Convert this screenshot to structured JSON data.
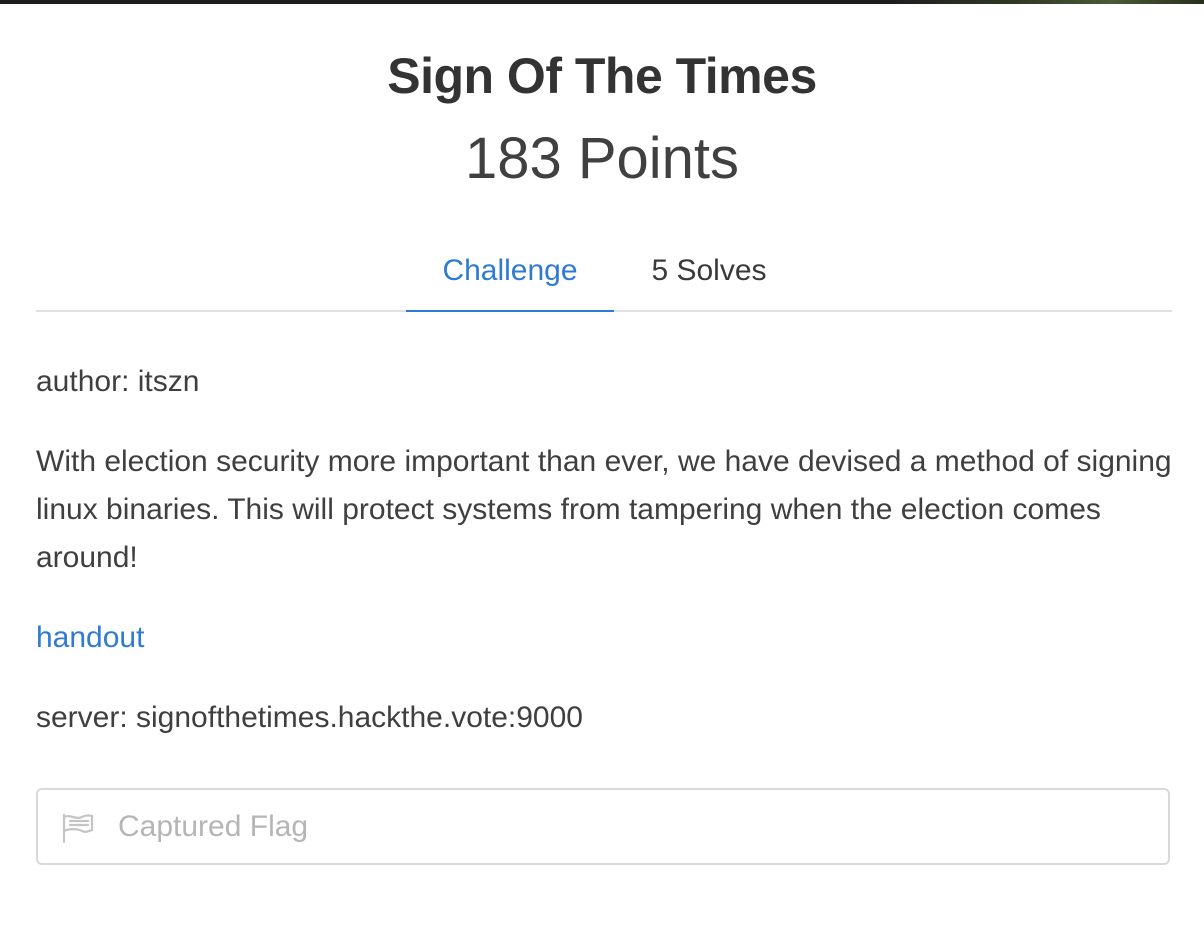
{
  "challenge": {
    "title": "Sign Of The Times",
    "points": "183 Points"
  },
  "tabs": [
    {
      "label": "Challenge",
      "active": true
    },
    {
      "label": "5 Solves",
      "active": false
    }
  ],
  "body": {
    "author": "author: itszn",
    "description": "With election security more important than ever, we have devised a method of signing linux binaries. This will protect systems from tampering when the election comes around!",
    "handout_link": "handout",
    "server": "server: signofthetimes.hackthe.vote:9000"
  },
  "flag_input": {
    "icon": "flag-icon",
    "placeholder": "Captured Flag",
    "value": ""
  },
  "colors": {
    "accent": "#2f7ad3",
    "text": "#3a3a3a",
    "border": "#d9d9d9"
  }
}
